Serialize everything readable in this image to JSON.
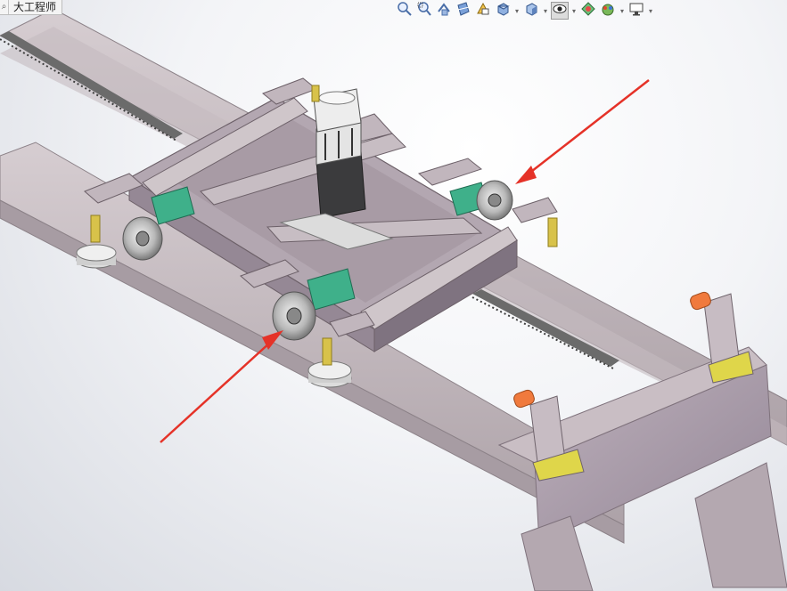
{
  "document": {
    "title": "大工程师",
    "search_glyph": "⌕"
  },
  "heads_up_toolbar": {
    "buttons": [
      {
        "name": "zoom-to-fit-icon"
      },
      {
        "name": "zoom-to-area-icon"
      },
      {
        "name": "previous-view-icon"
      },
      {
        "name": "section-view-icon"
      },
      {
        "name": "dynamic-annotation-icon"
      },
      {
        "name": "view-orientation-icon",
        "dropdown": true
      },
      {
        "name": "display-style-icon",
        "dropdown": true
      },
      {
        "name": "hide-show-items-icon",
        "dropdown": true,
        "active": true
      },
      {
        "name": "edit-appearance-icon"
      },
      {
        "name": "apply-scene-icon",
        "dropdown": true
      },
      {
        "name": "view-settings-icon",
        "dropdown": true
      }
    ],
    "caret_glyph": "▾"
  },
  "colors": {
    "frame": "#b9aeb3",
    "frame_dark": "#9a8f96",
    "frame_light": "#d2c9cd",
    "plate": "#a89aa6",
    "bearing": "#3fb08a",
    "brass": "#d8c24a",
    "accent_orange": "#f07a3d",
    "arrow": "#e53228",
    "rack": "#5f5f5f"
  }
}
